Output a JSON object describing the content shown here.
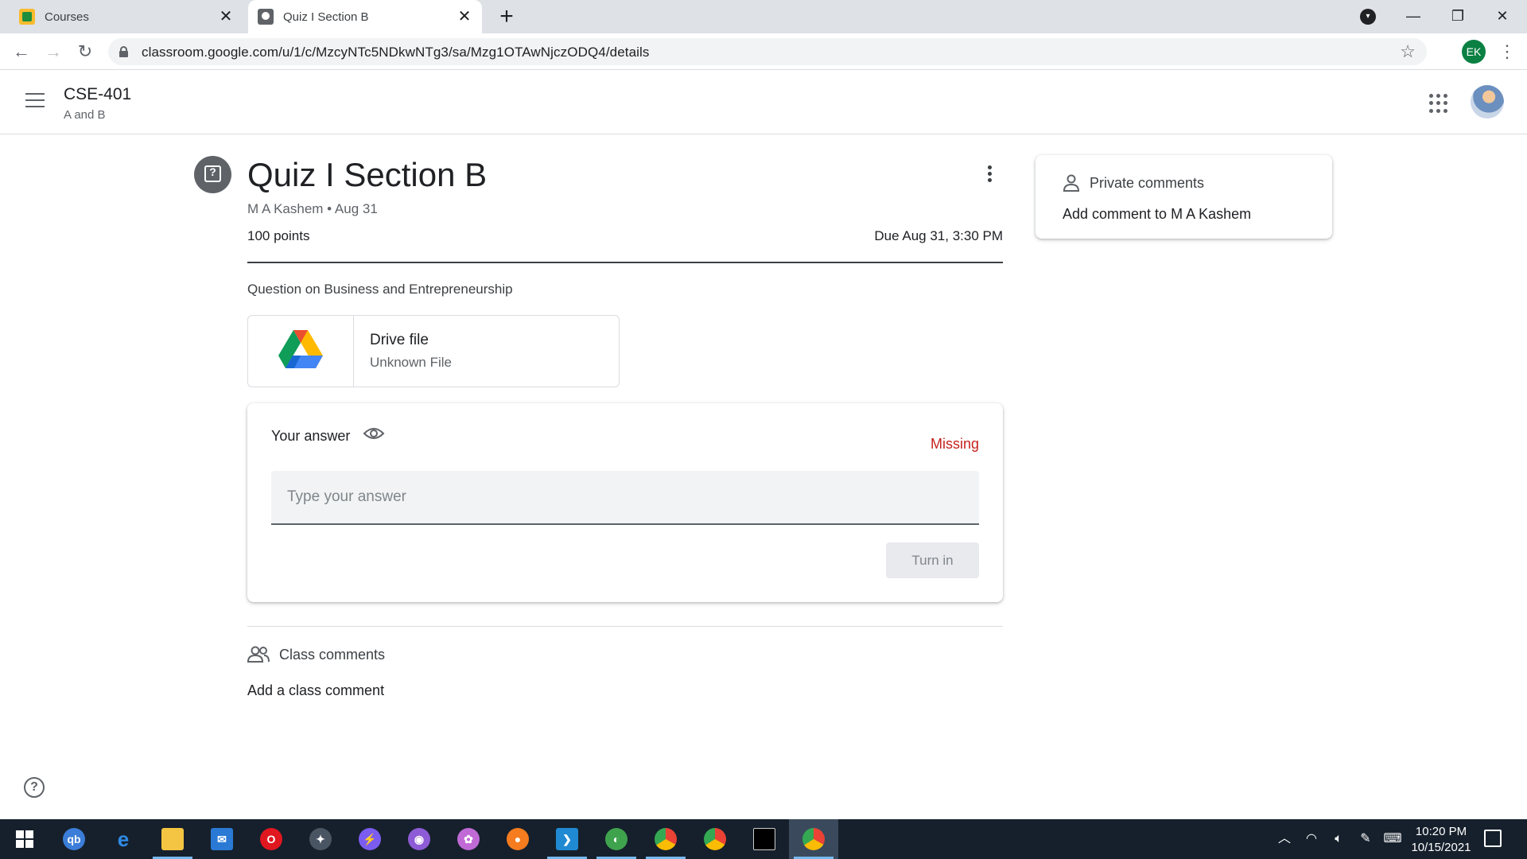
{
  "browser": {
    "tabs": [
      {
        "title": "Courses",
        "active": false
      },
      {
        "title": "Quiz I Section B",
        "active": true
      }
    ],
    "url": "classroom.google.com/u/1/c/MzcyNTc5NDkwNTg3/sa/Mzg1OTAwNjczODQ4/details",
    "account_initials": "EK",
    "new_tab_glyph": "+",
    "close_glyph": "✕"
  },
  "header": {
    "course_title": "CSE-401",
    "course_section": "A and B"
  },
  "assignment": {
    "title": "Quiz I Section B",
    "meta": "M A Kashem • Aug 31",
    "points": "100 points",
    "due": "Due Aug 31, 3:30 PM",
    "description": "Question on Business and Entrepreneurship",
    "attachment": {
      "title": "Drive file",
      "subtitle": "Unknown File",
      "icon": "google-drive-icon"
    }
  },
  "answer": {
    "label": "Your answer",
    "status": "Missing",
    "status_color": "#c5221f",
    "placeholder": "Type your answer",
    "value": "",
    "turn_in_label": "Turn in"
  },
  "class_comments": {
    "label": "Class comments",
    "add_label": "Add a class comment"
  },
  "private_comments": {
    "label": "Private comments",
    "add_label": "Add comment to M A Kashem"
  },
  "taskbar": {
    "apps": [
      "windows-start",
      "qb",
      "edge",
      "file-explorer",
      "mail",
      "opera",
      "satellite",
      "messenger",
      "github",
      "paint",
      "firefox",
      "vscode",
      "network-app",
      "chrome-profile",
      "chrome",
      "terminal",
      "chrome-ek"
    ],
    "time": "10:20 PM",
    "date": "10/15/2021"
  }
}
